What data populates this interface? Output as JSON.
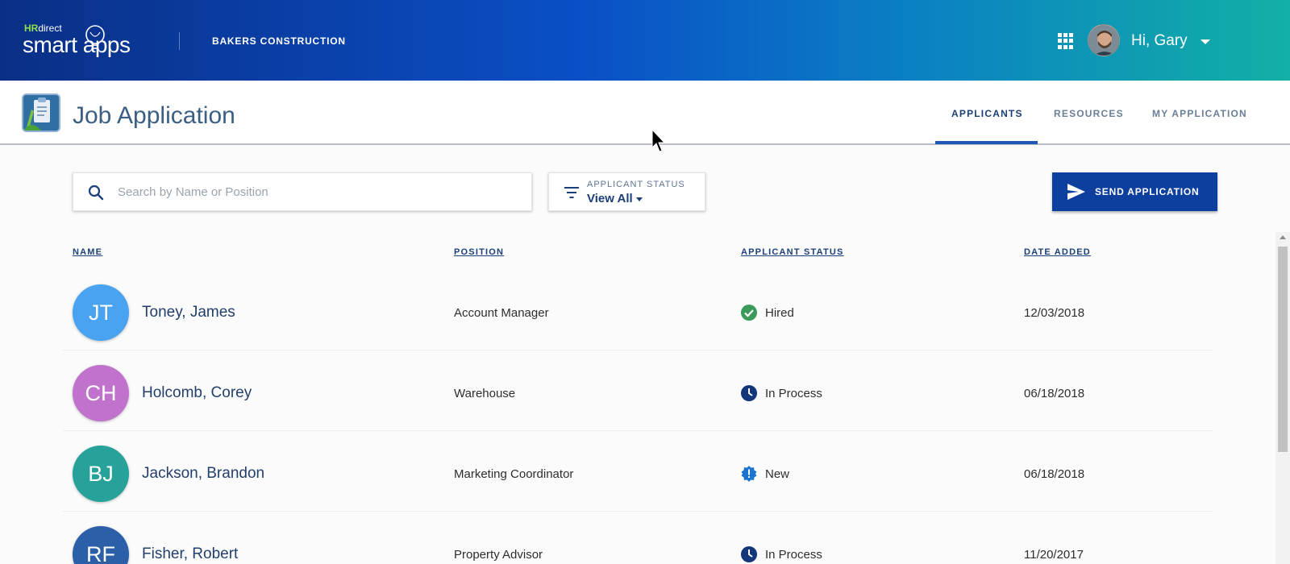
{
  "brand": {
    "hr": "HR",
    "direct": "direct",
    "product": "smart apps"
  },
  "company": "BAKERS CONSTRUCTION",
  "user": {
    "greeting": "Hi, Gary"
  },
  "app": {
    "title": "Job Application"
  },
  "tabs": [
    {
      "label": "APPLICANTS",
      "active": true
    },
    {
      "label": "RESOURCES",
      "active": false
    },
    {
      "label": "MY APPLICATION",
      "active": false
    }
  ],
  "search": {
    "placeholder": "Search by Name or Position",
    "value": ""
  },
  "filter": {
    "label": "APPLICANT STATUS",
    "value": "View All"
  },
  "send_button": {
    "label": "SEND APPLICATION"
  },
  "table": {
    "headers": {
      "name": "NAME",
      "position": "POSITION",
      "status": "APPLICANT STATUS",
      "date": "DATE ADDED"
    },
    "rows": [
      {
        "initials": "JT",
        "name": "Toney, James",
        "position": "Account Manager",
        "status": "Hired",
        "status_icon": "check-circle-icon",
        "date": "12/03/2018",
        "avatar_color": "#4aa3f0"
      },
      {
        "initials": "CH",
        "name": "Holcomb, Corey",
        "position": "Warehouse",
        "status": "In Process",
        "status_icon": "clock-icon",
        "date": "06/18/2018",
        "avatar_color": "#c072cc"
      },
      {
        "initials": "BJ",
        "name": "Jackson, Brandon",
        "position": "Marketing Coordinator",
        "status": "New",
        "status_icon": "badge-alert-icon",
        "date": "06/18/2018",
        "avatar_color": "#27a29a"
      },
      {
        "initials": "RF",
        "name": "Fisher, Robert",
        "position": "Property Advisor",
        "status": "In Process",
        "status_icon": "clock-icon",
        "date": "11/20/2017",
        "avatar_color": "#2b5fa8"
      }
    ]
  },
  "colors": {
    "accent": "#0d3f9f",
    "hired": "#3a9a5a",
    "in_process": "#12367a",
    "new": "#1a74d0"
  }
}
